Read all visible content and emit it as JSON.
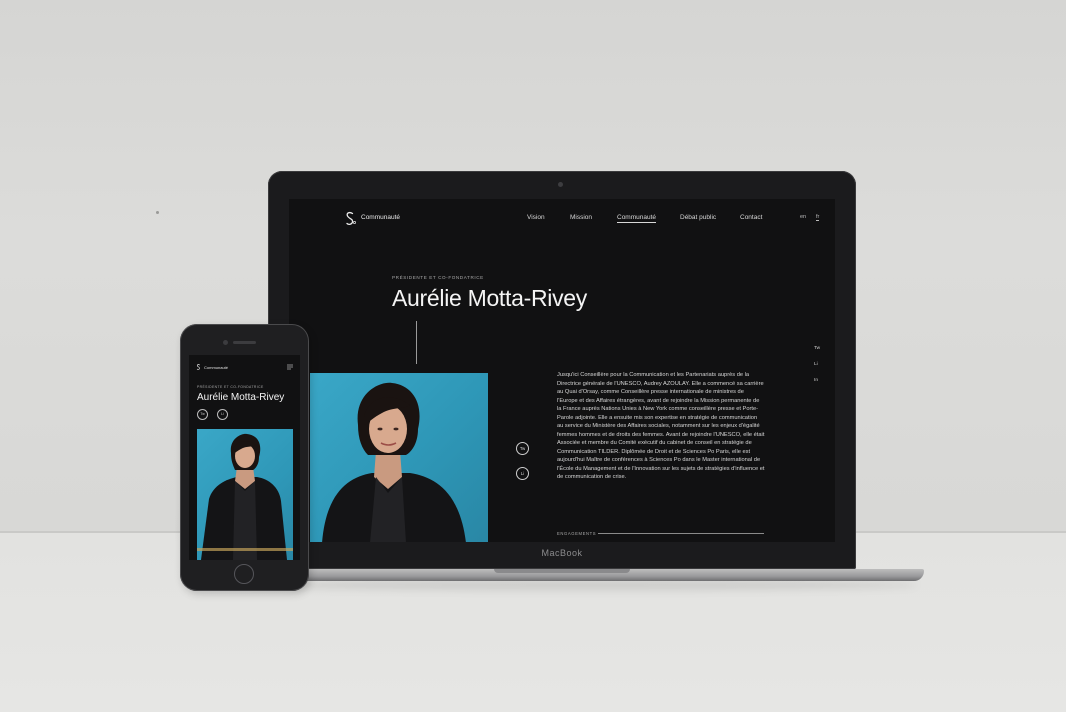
{
  "site": {
    "brand": "Communauté",
    "nav": [
      {
        "label": "Vision"
      },
      {
        "label": "Mission"
      },
      {
        "label": "Communauté"
      },
      {
        "label": "Débat public"
      },
      {
        "label": "Contact"
      }
    ],
    "active_nav": "Communauté",
    "languages": {
      "en": "en",
      "fr": "fr",
      "active": "fr"
    },
    "eyebrow": "PRÉSIDENTE ET CO-FONDATRICE",
    "name": "Aurélie Motta-Rivey",
    "social": {
      "twitter": "Tw",
      "linkedin": "Li",
      "instagram": "In"
    },
    "bio": "Jusqu'ici Conseillère pour la Communication et les Partenariats auprès de la Directrice générale de l'UNESCO, Audrey AZOULAY. Elle a commencé sa carrière au Quai d'Orsay, comme Conseillère presse internationale de ministres de l'Europe et des Affaires étrangères, avant de rejoindre la Mission permanente de la France auprès Nations Unies à New York comme conseillère presse et Porte-Parole adjointe. Elle a ensuite mis son expertise en stratégie de communication au service du Ministère des Affaires sociales, notamment sur les enjeux d'égalité femmes hommes et de droits des femmes. Avant de rejoindre l'UNESCO, elle était Associée et membre du Comité exécutif du cabinet de conseil en stratégie de Communication TILDER. Diplômée de Droit et de Sciences Po Paris, elle est aujourd'hui Maître de conférences à Sciences Po dans le Master international de l'École du Management et de l'Innovation sur les sujets de stratégies d'influence et de communication de crise.",
    "section_label": "ENGAGEMENTS"
  },
  "device": {
    "laptop_label": "MacBook"
  },
  "colors": {
    "screen_bg": "#111112",
    "photo_bg": "#2e97b7",
    "text": "#f4f4f4"
  }
}
